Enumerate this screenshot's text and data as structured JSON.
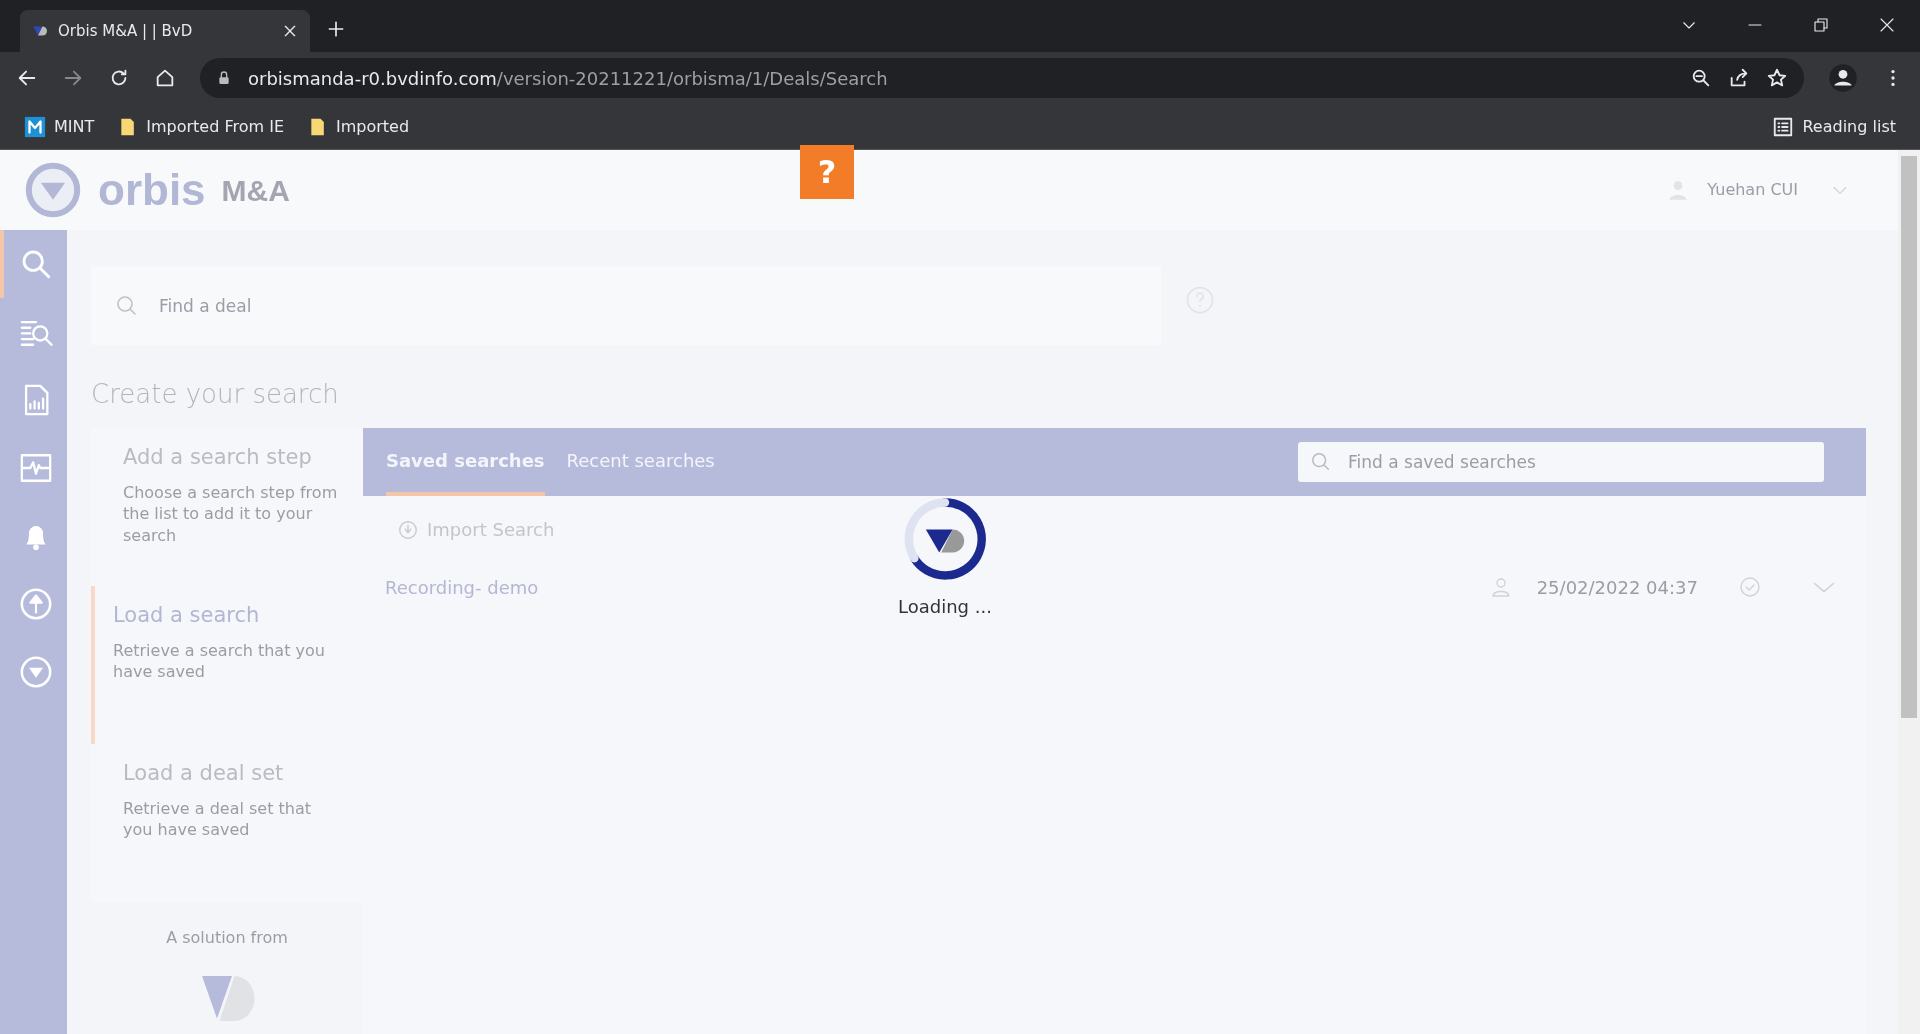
{
  "browser": {
    "tab_title": "Orbis M&A | | BvD",
    "url_host": "orbismanda-r0.bvdinfo.com",
    "url_path": "/version-20211221/orbisma/1/Deals/Search",
    "bookmarks": [
      {
        "label": "MINT",
        "kind": "mint"
      },
      {
        "label": "Imported From IE",
        "kind": "folder"
      },
      {
        "label": "Imported",
        "kind": "folder"
      }
    ],
    "reading_list": "Reading list"
  },
  "header": {
    "logo": "orbis",
    "logo_suffix": "M&A",
    "help": "?",
    "user": "Yuehan CUI"
  },
  "rail": [
    {
      "kind": "search",
      "selected": true
    },
    {
      "kind": "list-search",
      "selected": false
    },
    {
      "kind": "report",
      "selected": false
    },
    {
      "kind": "pulse",
      "selected": false
    },
    {
      "kind": "bell",
      "selected": false
    },
    {
      "kind": "upload",
      "selected": false
    },
    {
      "kind": "logo",
      "selected": false
    }
  ],
  "search": {
    "placeholder": "Find a deal"
  },
  "heading": "Create your search",
  "steps": [
    {
      "title": "Add a search step",
      "description": "Choose a search step from the list to add it to your search",
      "selected": false
    },
    {
      "title": "Load a search",
      "description": "Retrieve a search that you have saved",
      "selected": true
    },
    {
      "title": "Load a deal set",
      "description": "Retrieve a deal set that you have saved",
      "selected": false
    }
  ],
  "footer": "A solution from",
  "tabs": [
    {
      "label": "Saved searches",
      "selected": true
    },
    {
      "label": "Recent searches",
      "selected": false
    }
  ],
  "saved_search": {
    "placeholder": "Find a saved searches"
  },
  "import": "Import Search",
  "rows": [
    {
      "name": "Recording- demo",
      "date": "25/02/2022 04:37"
    }
  ],
  "loading": "Loading ..."
}
